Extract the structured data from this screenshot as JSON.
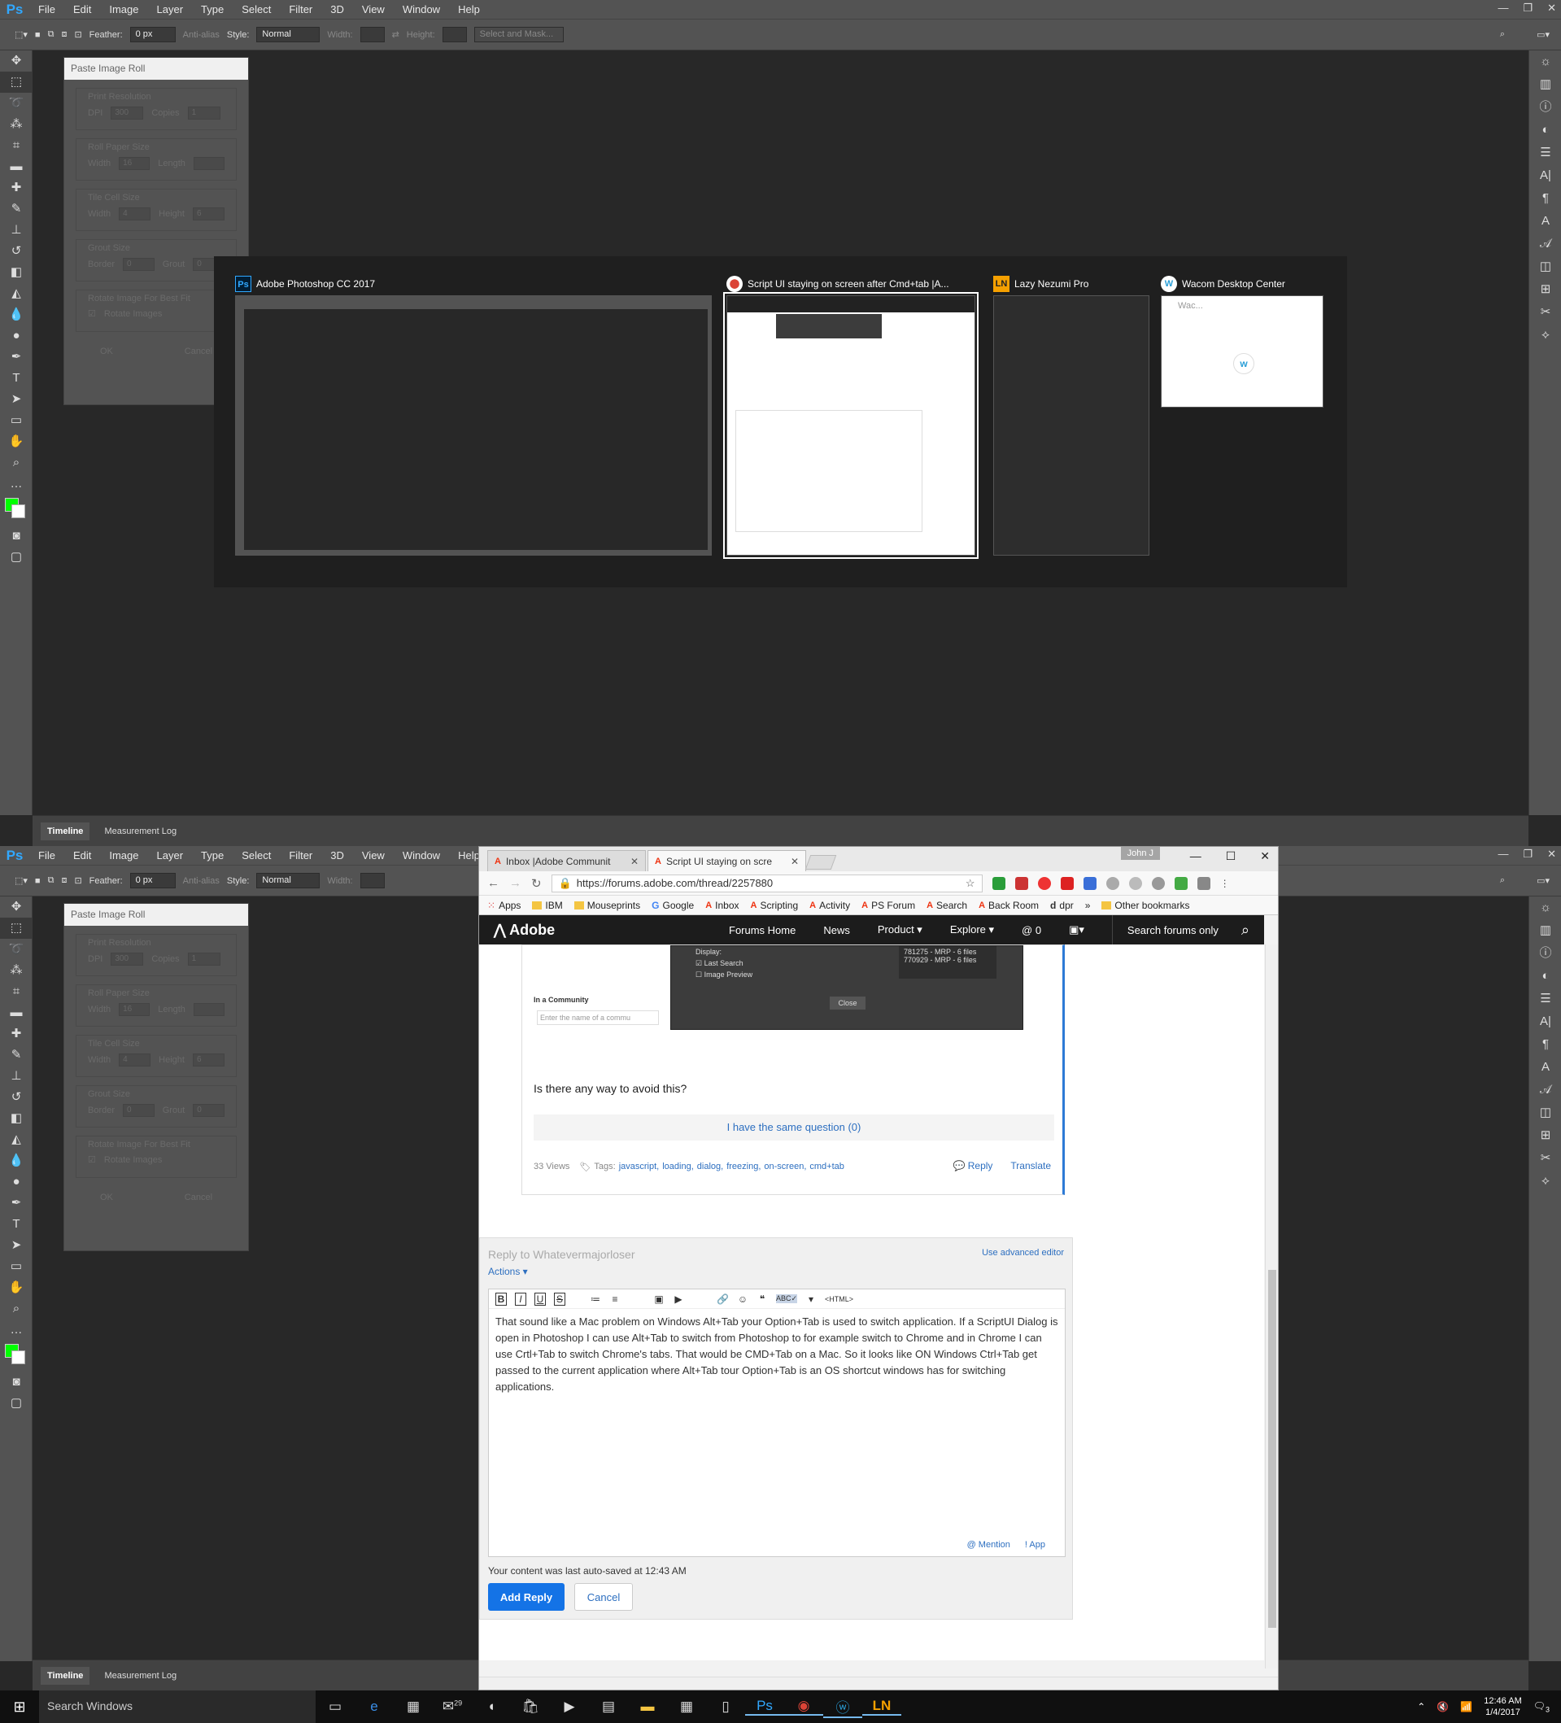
{
  "photoshop": {
    "logo": "Ps",
    "menu": [
      "File",
      "Edit",
      "Image",
      "Layer",
      "Type",
      "Select",
      "Filter",
      "3D",
      "View",
      "Window",
      "Help"
    ],
    "options": {
      "feather_label": "Feather:",
      "feather_value": "0 px",
      "antialias": "Anti-alias",
      "style_label": "Style:",
      "style_value": "Normal",
      "width_label": "Width:",
      "height_label": "Height:",
      "select_mask": "Select and Mask..."
    },
    "bottom_tabs": [
      "Timeline",
      "Measurement Log"
    ],
    "foreground_color": "#00ff00",
    "background_color": "#ffffff"
  },
  "dialog": {
    "title": "Paste Image Roll",
    "print_resolution": {
      "label": "Print Resolution",
      "dpi_label": "DPI",
      "dpi_value": "300",
      "copies_label": "Copies",
      "copies_value": "1"
    },
    "roll_paper": {
      "label": "Roll Paper Size",
      "width_label": "Width",
      "width_value": "16",
      "length_label": "Length",
      "length_value": ""
    },
    "tile_cell": {
      "label": "Tile Cell Size",
      "width_label": "Width",
      "width_value": "4",
      "height_label": "Height",
      "height_value": "6"
    },
    "grout": {
      "label": "Grout Size",
      "border_label": "Border",
      "border_value": "0",
      "grout_label": "Grout",
      "grout_value": "0"
    },
    "rotate": {
      "label": "Rotate Image For Best Fit",
      "checkbox_label": "Rotate Images"
    },
    "ok": "OK",
    "cancel": "Cancel"
  },
  "switcher": {
    "items": [
      {
        "icon": "Ps",
        "title": "Adobe Photoshop CC 2017"
      },
      {
        "icon": "⬤",
        "title": "Script UI staying on screen after Cmd+tab |A..."
      },
      {
        "icon": "LN",
        "title": "Lazy Nezumi Pro"
      },
      {
        "icon": "W",
        "title": "Wacom Desktop Center"
      }
    ],
    "wacom_thumb_title": "Wac..."
  },
  "chrome": {
    "tabs": [
      {
        "title": "Inbox |Adobe Communit"
      },
      {
        "title": "Script UI staying on scre"
      }
    ],
    "user": "John J",
    "url": "https://forums.adobe.com/thread/2257880",
    "bookmarks": [
      "Apps",
      "IBM",
      "Mouseprints",
      "Google",
      "Inbox",
      "Scripting",
      "Activity",
      "PS Forum",
      "Search",
      "Back Room",
      "dpr"
    ],
    "more": "»",
    "other_bookmarks": "Other bookmarks"
  },
  "adobe_site": {
    "logo": "Adobe",
    "nav": [
      "Forums Home",
      "News",
      "Product ▾",
      "Explore ▾"
    ],
    "notifications": "0",
    "search_label": "Search forums only",
    "embedded_screenshot": {
      "display_label": "Display:",
      "last_search": "Last Search",
      "image_preview": "Image Preview",
      "list": [
        "781275 - MRP - 6 files",
        "770929 - MRP - 6 files"
      ],
      "close": "Close",
      "community_label": "In a Community",
      "community_placeholder": "Enter the name of a commu"
    },
    "question": "Is there any way to avoid this?",
    "same_question": "I have the same question (0)",
    "views": "33 Views",
    "tags_label": "Tags:",
    "tags": [
      "javascript,",
      "loading,",
      "dialog,",
      "freezing,",
      "on-screen,",
      "cmd+tab"
    ],
    "reply_link": "Reply",
    "translate_link": "Translate",
    "reply_to": "Reply to Whatevermajorloser",
    "advanced_editor": "Use advanced editor",
    "actions": "Actions ▾",
    "editor_tools": [
      "B",
      "I",
      "U",
      "S",
      "≔",
      "≡",
      "▣",
      "▶",
      "🔗",
      "☺",
      "❝",
      "ABC✓",
      "▾",
      "<HTML>"
    ],
    "reply_text": "That sound like a Mac problem on Windows Alt+Tab your Option+Tab is used to switch application.  If a ScriptUI Dialog is open in Photoshop I can use Alt+Tab to switch from Photoshop to for example switch to Chrome and in Chrome I can use Crtl+Tab to switch Chrome's tabs.  That would be CMD+Tab on a Mac. So it looks like ON Windows Ctrl+Tab get passed to the current application where Alt+Tab tour Option+Tab is an OS shortcut windows has for switching applications.",
    "mention": "@ Mention",
    "app": "! App",
    "autosave": "Your content was last auto-saved at 12:43 AM",
    "add_reply": "Add Reply",
    "cancel": "Cancel"
  },
  "taskbar": {
    "search": "Search Windows",
    "mail_badge": "29",
    "time": "12:46 AM",
    "date": "1/4/2017",
    "notif_count": "3"
  }
}
